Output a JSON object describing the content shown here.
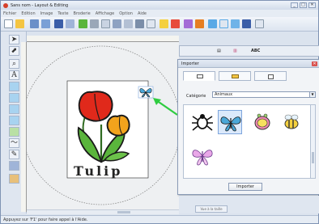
{
  "window": {
    "title": "Sans nom - Layout & Editing",
    "controls": [
      "_",
      "□",
      "✕"
    ]
  },
  "menu": {
    "items": [
      "Fichier",
      "Edition",
      "Image",
      "Texte",
      "Broderie",
      "Affichage",
      "Option",
      "Aide"
    ]
  },
  "panel": {
    "tab_labels": [
      "▤",
      "▥",
      "ABC"
    ]
  },
  "dialog": {
    "title": "Importer",
    "category_label": "Catégorie",
    "category_value": "Animaux",
    "import_button": "Importer",
    "thumbnails": [
      "spider",
      "butterfly-blue",
      "ladybug",
      "bee",
      "butterfly-pink"
    ],
    "selected_thumbnail": "butterfly-blue"
  },
  "canvas": {
    "design_text": "Tulip"
  },
  "bottom": {
    "view_button": "Vue à la taille"
  },
  "status": {
    "text": "Appuyez sur 'F1' pour faire appel à l'Aide."
  },
  "colors": {
    "accent_arrow": "#2ecc40",
    "tulip_red": "#e0291b",
    "tulip_orange": "#f2a31c",
    "leaf_green": "#5ab53c",
    "butterfly_blue": "#4aa7d8"
  }
}
